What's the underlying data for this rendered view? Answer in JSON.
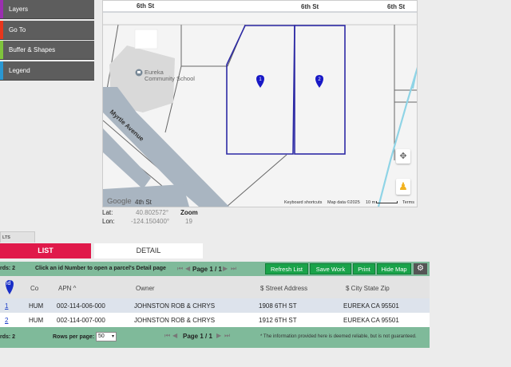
{
  "menu": {
    "items": [
      {
        "label": "Layers",
        "color": "#9b2fb0"
      },
      {
        "label": "Go To",
        "color": "#e8361c"
      },
      {
        "label": "Buffer & Shapes",
        "color": "#7fc43c"
      },
      {
        "label": "Legend",
        "color": "#2a97d2"
      }
    ]
  },
  "map": {
    "streets": {
      "top_left": "6th St",
      "top_mid": "6th St",
      "top_right": "6th St",
      "myrtle": "Myrtle Avenue",
      "bottom": "4th St"
    },
    "poi": "Eureka Community School",
    "poi_line1": "Eureka",
    "poi_line2": "Community School",
    "markers": [
      "1",
      "2"
    ],
    "google": "Google",
    "attribution": {
      "shortcuts": "Keyboard shortcuts",
      "data": "Map data ©2025",
      "scale": "10 m",
      "terms": "Terms"
    }
  },
  "coords": {
    "lat_label": "Lat:",
    "lat_value": "40.802572°",
    "lon_label": "Lon:",
    "lon_value": "-124.150400°",
    "zoom_label": "Zoom",
    "zoom_value": "19"
  },
  "tabs": {
    "small": "LTS",
    "list": "LIST",
    "detail": "DETAIL"
  },
  "toolbar": {
    "records": "rds: 2",
    "hint": "Click an id Number to open a parcel's Detail page",
    "page_label": "Page 1 / 1",
    "buttons": [
      "Refresh List",
      "Save Work",
      "Print",
      "Hide Map"
    ]
  },
  "table": {
    "headers": {
      "id": "id",
      "co": "Co",
      "apn": "APN ^",
      "owner": "Owner",
      "street": "$ Street Address",
      "city": "$ City State Zip"
    },
    "rows": [
      {
        "id": "1",
        "co": "HUM",
        "apn": "002-114-006-000",
        "owner": "JOHNSTON ROB & CHRYS",
        "street": "1908 6TH ST",
        "city": "EUREKA CA 95501"
      },
      {
        "id": "2",
        "co": "HUM",
        "apn": "002-114-007-000",
        "owner": "JOHNSTON ROB & CHRYS",
        "street": "1912 6TH ST",
        "city": "EUREKA CA 95501"
      }
    ]
  },
  "footer": {
    "records": "rds: 2",
    "rows_per_page_label": "Rows per page:",
    "rows_per_page_value": "50",
    "page_label": "Page 1 / 1",
    "disclaimer": "* The information provided here is deemed reliable, but is not guaranteed."
  }
}
